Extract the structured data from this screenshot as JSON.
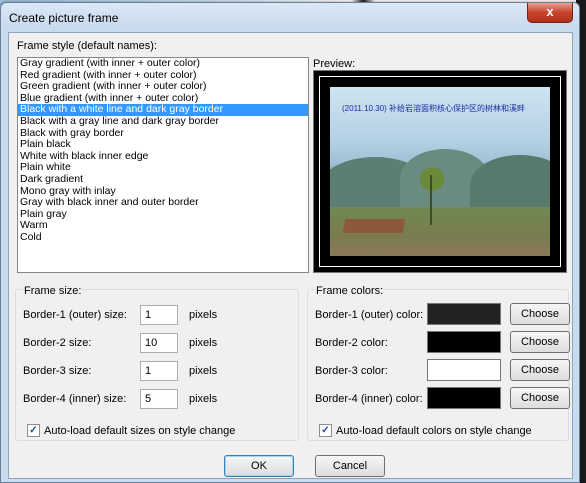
{
  "dialog": {
    "title": "Create picture frame",
    "close_label": "x"
  },
  "frame_style": {
    "label": "Frame style (default names):",
    "selected_index": 4,
    "items": [
      "Gray gradient (with inner + outer color)",
      "Red gradient (with inner + outer color)",
      "Green gradient (with inner + outer color)",
      "Blue gradient (with inner + outer color)",
      "Black with a white line and dark gray border",
      "Black with a gray line and dark gray border",
      "Black with gray border",
      "Plain black",
      "White with black inner edge",
      "Plain white",
      "Dark gradient",
      "Mono gray with inlay",
      "Gray with black inner and outer border",
      "Plain gray",
      "Warm",
      "Cold"
    ]
  },
  "preview": {
    "label": "Preview:",
    "caption": "(2011.10.30) 补给岩溶面积核心保护区的树林和溪畔"
  },
  "frame_size": {
    "label": "Frame size:",
    "unit": "pixels",
    "rows": [
      {
        "label": "Border-1 (outer) size:",
        "value": "1"
      },
      {
        "label": "Border-2 size:",
        "value": "10"
      },
      {
        "label": "Border-3 size:",
        "value": "1"
      },
      {
        "label": "Border-4 (inner) size:",
        "value": "5"
      }
    ],
    "autoload_label": "Auto-load default sizes on style change",
    "autoload_checked": true
  },
  "frame_colors": {
    "label": "Frame colors:",
    "choose_label": "Choose",
    "rows": [
      {
        "label": "Border-1 (outer) color:",
        "color": "#222222"
      },
      {
        "label": "Border-2 color:",
        "color": "#000000"
      },
      {
        "label": "Border-3 color:",
        "color": "#ffffff"
      },
      {
        "label": "Border-4 (inner) color:",
        "color": "#000000"
      }
    ],
    "autoload_label": "Auto-load default colors on style change",
    "autoload_checked": true
  },
  "buttons": {
    "ok_label": "OK",
    "cancel_label": "Cancel"
  }
}
